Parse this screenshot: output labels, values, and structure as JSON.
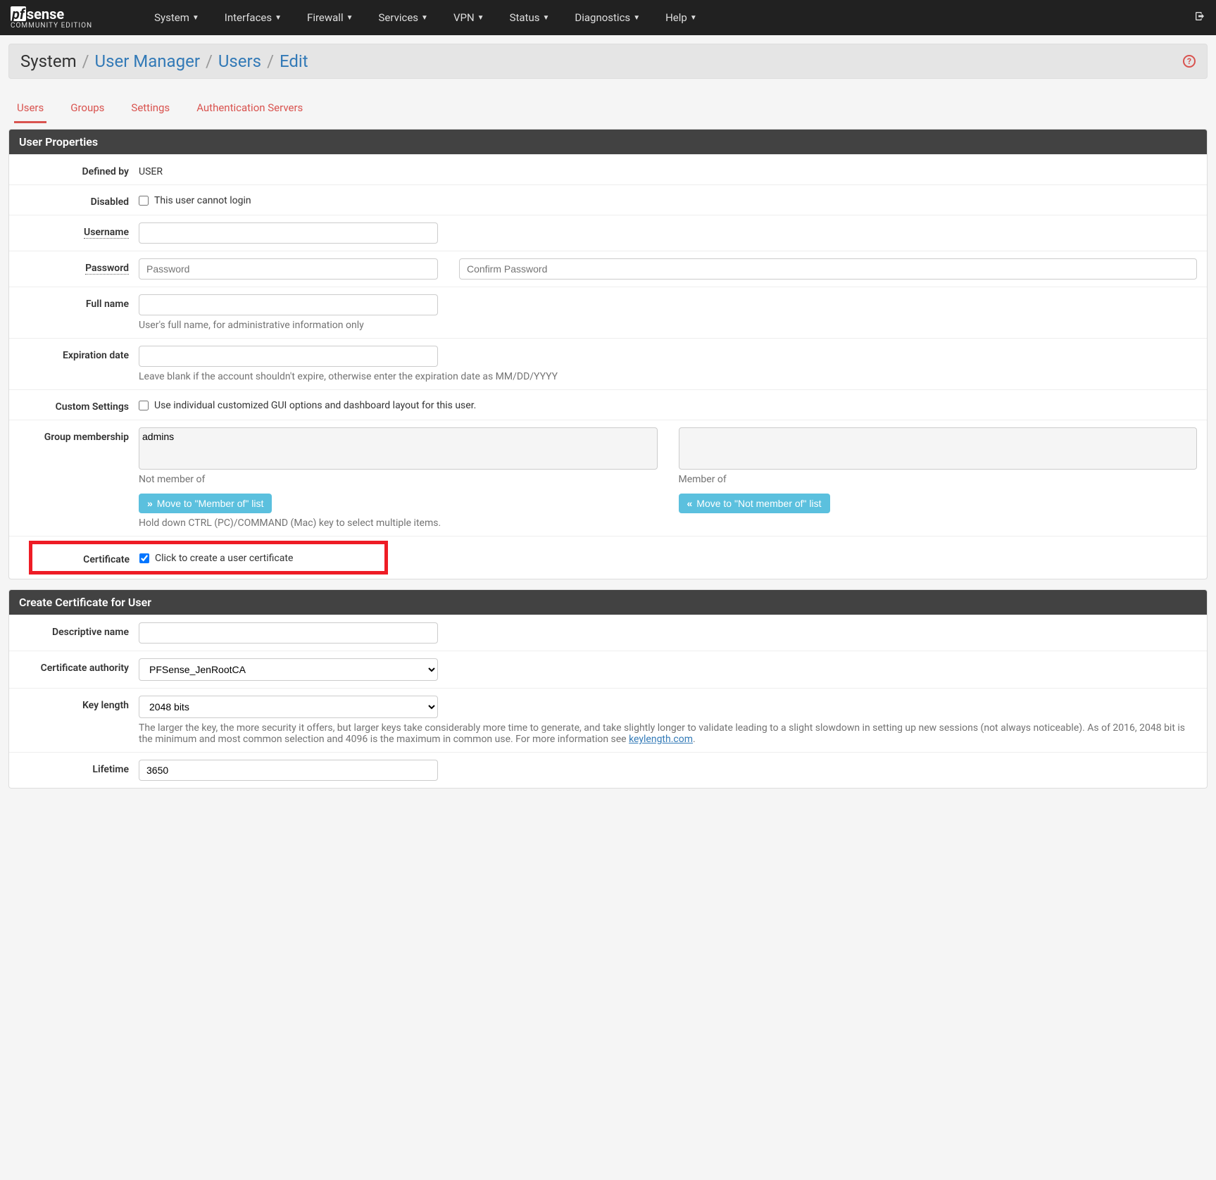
{
  "navbar": {
    "items": [
      "System",
      "Interfaces",
      "Firewall",
      "Services",
      "VPN",
      "Status",
      "Diagnostics",
      "Help"
    ],
    "brand_pf": "pf",
    "brand_sense": "sense",
    "brand_edition": "COMMUNITY EDITION"
  },
  "breadcrumb": {
    "items": [
      "System",
      "User Manager",
      "Users",
      "Edit"
    ]
  },
  "tabs": [
    "Users",
    "Groups",
    "Settings",
    "Authentication Servers"
  ],
  "panel1": {
    "title": "User Properties",
    "defined_by_label": "Defined by",
    "defined_by_value": "USER",
    "disabled_label": "Disabled",
    "disabled_text": "This user cannot login",
    "username_label": "Username",
    "password_label": "Password",
    "password_placeholder": "Password",
    "confirm_placeholder": "Confirm Password",
    "fullname_label": "Full name",
    "fullname_help": "User's full name, for administrative information only",
    "expiration_label": "Expiration date",
    "expiration_help": "Leave blank if the account shouldn't expire, otherwise enter the expiration date as MM/DD/YYYY",
    "custom_label": "Custom Settings",
    "custom_text": "Use individual customized GUI options and dashboard layout for this user.",
    "group_label": "Group membership",
    "group_option": "admins",
    "not_member_label": "Not member of",
    "member_label": "Member of",
    "move_to_member": "Move to \"Member of\" list",
    "move_to_not_member": "Move to \"Not member of\" list",
    "group_help": "Hold down CTRL (PC)/COMMAND (Mac) key to select multiple items.",
    "certificate_label": "Certificate",
    "certificate_text": "Click to create a user certificate"
  },
  "panel2": {
    "title": "Create Certificate for User",
    "descname_label": "Descriptive name",
    "ca_label": "Certificate authority",
    "ca_value": "PFSense_JenRootCA",
    "keylen_label": "Key length",
    "keylen_value": "2048 bits",
    "keylen_help_1": "The larger the key, the more security it offers, but larger keys take considerably more time to generate, and take slightly longer to validate leading to a slight slowdown in setting up new sessions (not always noticeable). As of 2016, 2048 bit is the minimum and most common selection and 4096 is the maximum in common use. For more information see ",
    "keylen_help_link": "keylength.com",
    "keylen_help_2": ".",
    "lifetime_label": "Lifetime",
    "lifetime_value": "3650"
  }
}
